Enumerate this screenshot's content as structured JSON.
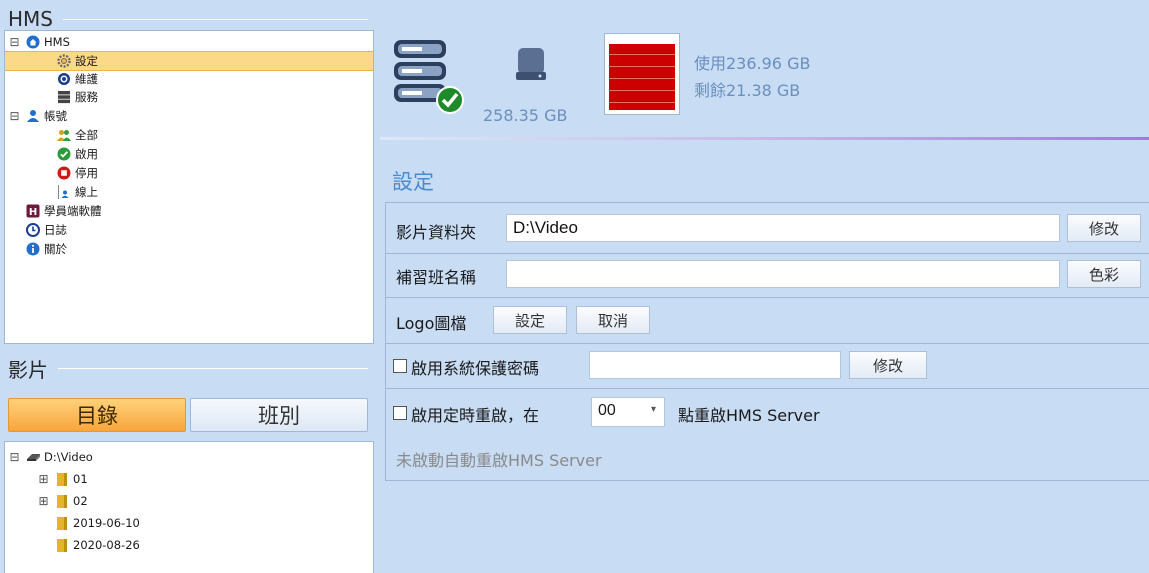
{
  "left": {
    "hms_section_title": "HMS",
    "tree": {
      "root": "HMS",
      "settings": "設定",
      "maintenance": "維護",
      "service": "服務",
      "account": "帳號",
      "all": "全部",
      "enabled": "啟用",
      "disabled": "停用",
      "online": "線上",
      "student_software": "學員端軟體",
      "log": "日誌",
      "about": "關於"
    },
    "video_section_title": "影片",
    "tabs": {
      "directory": "目錄",
      "class": "班別"
    },
    "folders": {
      "drive": "D:\\Video",
      "items": [
        "01",
        "02",
        "2019-06-10",
        "2020-08-26"
      ]
    }
  },
  "storage": {
    "total": "258.35 GB",
    "used": "使用236.96 GB",
    "free": "剩餘21.38 GB",
    "used_fraction": 0.917,
    "bar_color": "#cc0000"
  },
  "settings": {
    "title": "設定",
    "video_folder_label": "影片資料夾",
    "video_folder_value": "D:\\Video",
    "modify_label": "修改",
    "school_name_label": "補習班名稱",
    "school_name_value": "",
    "color_label": "色彩",
    "logo_label": "Logo圖檔",
    "logo_set_label": "設定",
    "logo_cancel_label": "取消",
    "protect_password_label": "啟用系統保護密碼",
    "protect_password_value": "",
    "protect_modify_label": "修改",
    "restart_label": "啟用定時重啟，在",
    "restart_hour": "00",
    "restart_suffix": "點重啟HMS Server",
    "restart_status": "未啟動自動重啟HMS Server"
  },
  "colors": {
    "accent": "#4a8ad0",
    "background": "#c8dcf4",
    "selected_row": "#fcd889"
  }
}
